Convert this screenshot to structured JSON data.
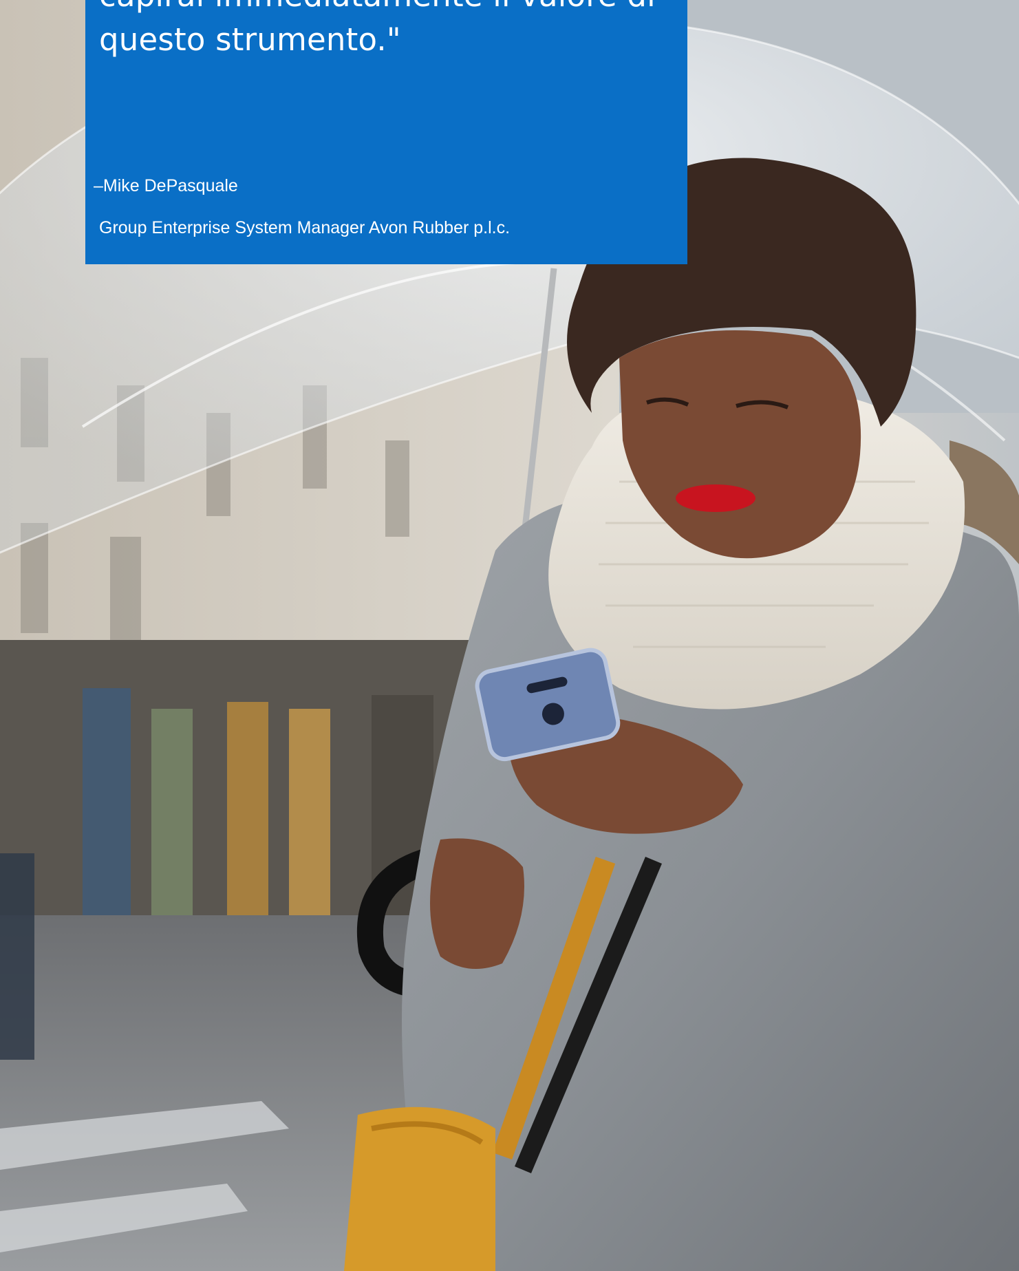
{
  "quote": {
    "lines": [
      "capirai immediatamente il valore di",
      "questo strumento.\""
    ],
    "author": "–Mike DePasquale",
    "role": "Group Enterprise System Manager Avon Rubber p.l.c.",
    "card_color": "#0a6fc6"
  },
  "photo": {
    "description_icons": [
      "umbrella-icon",
      "smartphone-icon",
      "handbag-icon"
    ]
  }
}
